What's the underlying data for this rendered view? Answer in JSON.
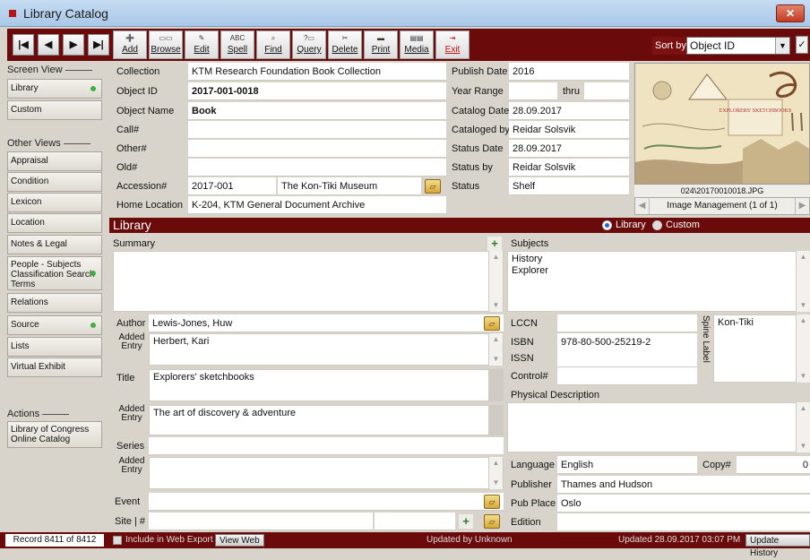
{
  "window": {
    "title": "Library Catalog",
    "close_glyph": "✕"
  },
  "toolbar": {
    "nav": [
      "|◀",
      "◀",
      "▶",
      "▶|"
    ],
    "buttons": [
      {
        "icon": "add-icon",
        "glyph": "➕",
        "label": "Add"
      },
      {
        "icon": "browse-icon",
        "glyph": "▭▭",
        "label": "Browse"
      },
      {
        "icon": "edit-icon",
        "glyph": "✎",
        "label": "Edit"
      },
      {
        "icon": "spell-icon",
        "glyph": "ABC",
        "label": "Spell"
      },
      {
        "icon": "find-icon",
        "glyph": "⌕",
        "label": "Find"
      },
      {
        "icon": "query-icon",
        "glyph": "?▭",
        "label": "Query"
      },
      {
        "icon": "delete-icon",
        "glyph": "✂",
        "label": "Delete"
      },
      {
        "icon": "print-icon",
        "glyph": "▬",
        "label": "Print"
      },
      {
        "icon": "media-icon",
        "glyph": "▤▤",
        "label": "Media"
      },
      {
        "icon": "exit-icon",
        "glyph": "⇥",
        "label": "Exit"
      }
    ],
    "sort_label": "Sort by",
    "sort_value": "Object ID",
    "check_glyph": "✓"
  },
  "sidebar": {
    "screen_view_heading": "Screen View",
    "screen_views": [
      {
        "label": "Library",
        "dot": true
      },
      {
        "label": "Custom",
        "dot": false
      }
    ],
    "other_views_heading": "Other Views",
    "other_views": [
      {
        "label": "Appraisal",
        "dot": false
      },
      {
        "label": "Condition",
        "dot": false
      },
      {
        "label": "Lexicon",
        "dot": false
      },
      {
        "label": "Location",
        "dot": false
      },
      {
        "label": "Notes & Legal",
        "dot": false
      },
      {
        "label": "People - Subjects Classification Search Terms",
        "dot": true
      },
      {
        "label": "Relations",
        "dot": false
      },
      {
        "label": "Source",
        "dot": true
      },
      {
        "label": "Lists",
        "dot": false
      },
      {
        "label": "Virtual Exhibit",
        "dot": false
      }
    ],
    "actions_heading": "Actions",
    "actions": [
      {
        "label": "Library of Congress Online Catalog"
      }
    ]
  },
  "record": {
    "collection_label": "Collection",
    "collection": "KTM Research Foundation Book Collection",
    "object_id_label": "Object ID",
    "object_id": "2017-001-0018",
    "object_name_label": "Object Name",
    "object_name": "Book",
    "call_label": "Call#",
    "call": "",
    "other_label": "Other#",
    "other": "",
    "old_label": "Old#",
    "old": "",
    "accession_label": "Accession#",
    "accession": "2017-001",
    "accession_source": "The Kon-Tiki Museum",
    "home_location_label": "Home Location",
    "home_location": "K-204, KTM General Document Archive",
    "publish_date_label": "Publish Date",
    "publish_date": "2016",
    "year_range_label": "Year Range",
    "year_range_from": "",
    "thru_label": "thru",
    "year_range_to": "",
    "catalog_date_label": "Catalog Date",
    "catalog_date": "28.09.2017",
    "cataloged_by_label": "Cataloged by",
    "cataloged_by": "Reidar Solsvik",
    "status_date_label": "Status Date",
    "status_date": "28.09.2017",
    "status_by_label": "Status by",
    "status_by": "Reidar Solsvik",
    "status_label": "Status",
    "status": "Shelf"
  },
  "image": {
    "caption": "024\\20170010018.JPG",
    "management": "Image Management (1 of 1)",
    "art_title": "EXPLORERS' SKETCHBOOKS",
    "prev_glyph": "◀",
    "next_glyph": "▶"
  },
  "library": {
    "title": "Library",
    "radio_library": "Library",
    "radio_custom": "Custom",
    "summary_label": "Summary",
    "summary": "",
    "subjects_label": "Subjects",
    "subjects": [
      "History",
      "Explorer"
    ],
    "author_label": "Author",
    "author": "Lewis-Jones, Huw",
    "added_entry_label": "Added Entry",
    "added_entry_author": "Herbert, Kari",
    "title_label": "Title",
    "title_value": "Explorers' sketchbooks",
    "added_entry_title": "The art of discovery & adventure",
    "series_label": "Series",
    "series": "",
    "added_entry_series": "",
    "event_label": "Event",
    "event": "",
    "site_label": "Site | #",
    "site": "",
    "lccn_label": "LCCN",
    "lccn": "",
    "isbn_label": "ISBN",
    "isbn": "978-80-500-25219-2",
    "issn_label": "ISSN",
    "issn": "",
    "control_label": "Control#",
    "control": "",
    "spine_label_label": "Spine Label",
    "spine_label": "Kon-Tiki",
    "physical_description_label": "Physical Description",
    "physical_description": "",
    "language_label": "Language",
    "language": "English",
    "copy_label": "Copy#",
    "copy": "0",
    "publisher_label": "Publisher",
    "publisher": "Thames and Hudson",
    "pub_place_label": "Pub Place",
    "pub_place": "Oslo",
    "edition_label": "Edition",
    "edition": ""
  },
  "status": {
    "record": "Record 8411 of 8412",
    "web_export": "Include in Web Export",
    "view_web": "View Web",
    "updated_by": "Updated by  Unknown",
    "updated": "Updated   28.09.2017 03:07 PM",
    "update_history": "Update History"
  },
  "colors": {
    "toolbar": "#6a0a0a",
    "accent_dot": "#3cb43c",
    "radio_on": "#1a6adb"
  }
}
